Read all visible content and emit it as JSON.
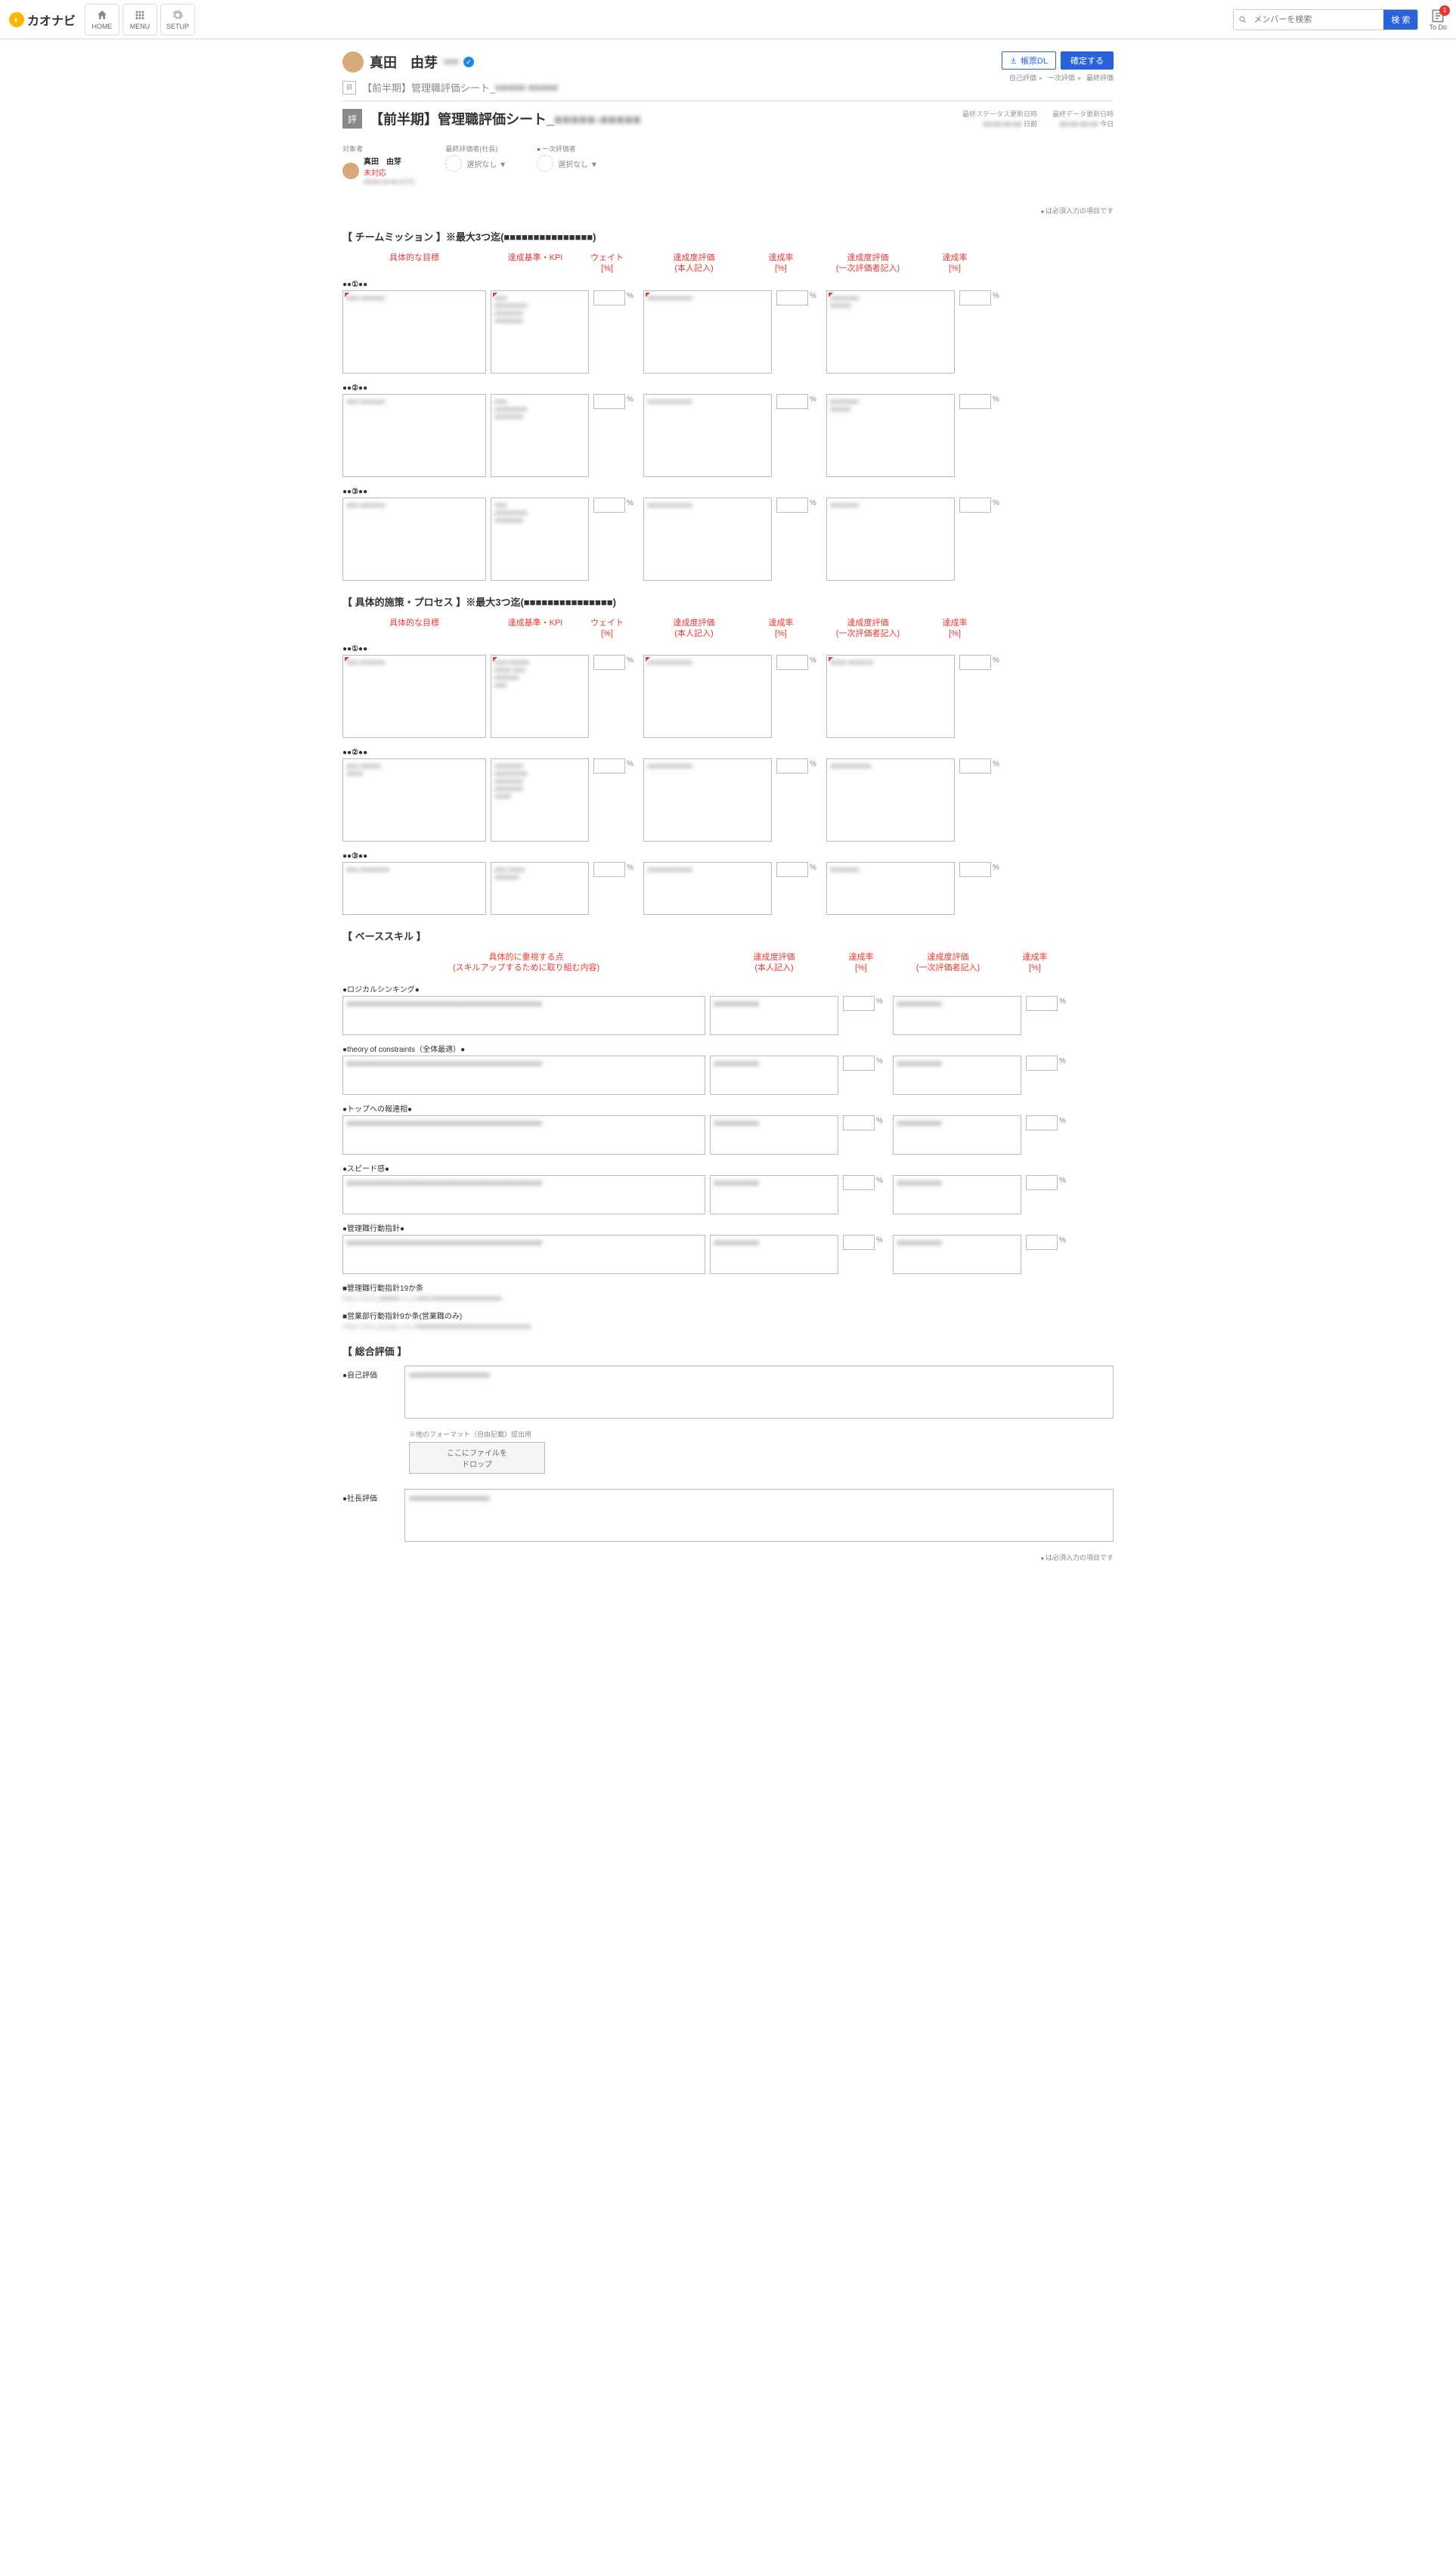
{
  "header": {
    "logo": "カオナビ",
    "nav": {
      "home": "HOME",
      "menu": "MENU",
      "setup": "SETUP"
    },
    "search_placeholder": "メンバーを検索",
    "search_btn": "検 索",
    "todo": "To Do",
    "todo_count": "1"
  },
  "person": {
    "name": "真田　由芽",
    "dept_blur": "■■■"
  },
  "doc_prev": {
    "title": "【前半期】管理職評価シート_",
    "suffix_blur": "■■■■■-■■■■■"
  },
  "sheet": {
    "icon": "評",
    "title": "【前半期】管理職評価シート_",
    "title_suffix_blur": "■■■■■-■■■■■",
    "status_lbl": "最終ステータス更新日時",
    "status_val_blur": "■■/■■ ■■:■■",
    "status_val2": "日前",
    "data_lbl": "最終データ更新日時",
    "data_val_blur": "■■/■■ ■■:■■",
    "data_val2": "今日"
  },
  "actions": {
    "dl": "帳票DL",
    "confirm": "確定する"
  },
  "breadcrumb": {
    "a": "自己評価",
    "b": "一次評価",
    "c": "最終評価"
  },
  "assignees": {
    "target_lbl": "対象者",
    "target_name": "真田　由芽",
    "target_sub": "未対応",
    "target_date_blur": "■■/■■ ■■:■■ ■日前",
    "final_lbl": "最終評価者(社長)",
    "final_val": "選択なし ▼",
    "first_lbl": "一次評価者",
    "first_val": "選択なし ▼"
  },
  "req_note": "は必須入力の項目です",
  "sections": {
    "mission": {
      "title": "【 チームミッション 】※最大3つ迄(■■■■■■■■■■■■■■■)"
    },
    "process": {
      "title": "【 具体的施策・プロセス 】※最大3つ迄(■■■■■■■■■■■■■■■)"
    },
    "skill": {
      "title": "【 ベーススキル 】"
    },
    "overall": {
      "title": "【 総合評価 】"
    }
  },
  "columns": {
    "goal": "具体的な目標",
    "kpi": "達成基準・KPI",
    "weight": "ウェイト\n[%]",
    "self_eval": "達成度評価\n(本人記入)",
    "rate1": "達成率\n[%]",
    "first_eval": "達成度評価\n(一次評価者記入)",
    "rate2": "達成率\n[%]"
  },
  "skill_columns": {
    "focus": "具体的に重視する点\n(スキルアップするために取り組む内容)",
    "self": "達成度評価\n(本人記入)",
    "r1": "達成率\n[%]",
    "first": "達成度評価\n(一次評価者記入)",
    "r2": "達成率\n[%]"
  },
  "rows": {
    "r1": "●●①●●",
    "r2": "●●②●●",
    "r3": "●●③●●"
  },
  "skills": {
    "s1": "●ロジカルシンキング●",
    "s2": "●theory of constraints（全体最適）●",
    "s3": "●トップへの報連相●",
    "s4": "●スピード感●",
    "s5": "●管理職行動指針●",
    "link1_lbl": "■管理職行動指針19か条",
    "link1_blur": "https://www.■■■■■.co.jp/■■■/■■■■■■■■■■■■■■■■■",
    "link2_lbl": "■営業部行動指針9か条(営業職のみ)",
    "link2_blur": "https://docs.google.com/■■■■■■■■■■■■■■■■■■■■■■■■■■■■"
  },
  "overall": {
    "self_lbl": "●自己評価",
    "format_note": "※他のフォーマット（自由記載）提出用",
    "drop1": "ここにファイルを",
    "drop2": "ドロップ",
    "boss_lbl": "●社長評価"
  }
}
